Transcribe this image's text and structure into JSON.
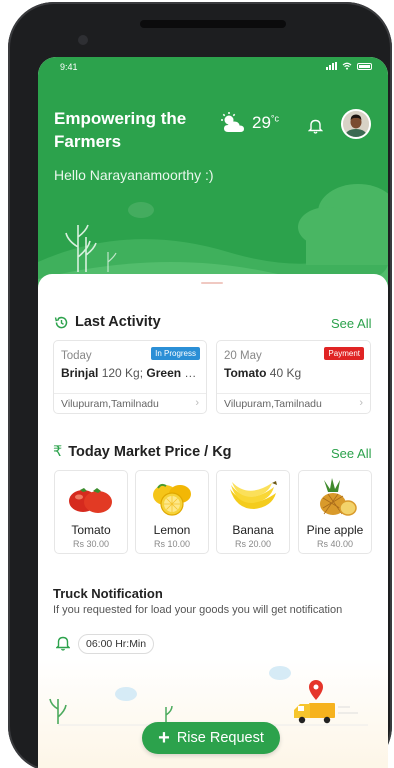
{
  "status_bar": {
    "time": "9:41"
  },
  "header": {
    "headline": "Empowering the Farmers",
    "greeting": "Hello Narayanamoorthy :)",
    "weather": {
      "icon": "partly-cloudy-icon",
      "temperature": "29",
      "unit": "°c"
    }
  },
  "last_activity": {
    "title": "Last Activity",
    "see_all": "See All",
    "cards": [
      {
        "date": "Today",
        "badge": "In Progress",
        "badge_color": "#2b8fd6",
        "item1_name": "Brinjal",
        "item1_qty": "120 Kg;",
        "item2_name": "Green C...",
        "item2_qty": "",
        "location": "Vilupuram,Tamilnadu"
      },
      {
        "date": "20 May",
        "badge": "Payment",
        "badge_color": "#e02424",
        "item1_name": "Tomato",
        "item1_qty": "40 Kg",
        "item2_name": "",
        "item2_qty": "",
        "location": "Vilupuram,Tamilnadu"
      }
    ]
  },
  "market": {
    "currency": "₹",
    "title": "Today Market Price / Kg",
    "see_all": "See All",
    "products": [
      {
        "name": "Tomato",
        "price": "Rs 30.00",
        "icon": "tomato-icon"
      },
      {
        "name": "Lemon",
        "price": "Rs 10.00",
        "icon": "lemon-icon"
      },
      {
        "name": "Banana",
        "price": "Rs 20.00",
        "icon": "banana-icon"
      },
      {
        "name": "Pine apple",
        "price": "Rs 40.00",
        "icon": "pineapple-icon"
      }
    ]
  },
  "truck": {
    "title": "Truck Notification",
    "description": "If you requested for load your goods you will get notification",
    "time": "06:00 Hr:Min"
  },
  "cta": {
    "label": "Rise Request"
  },
  "colors": {
    "primary": "#2ca24c",
    "in_progress": "#2b8fd6",
    "payment": "#e02424"
  }
}
